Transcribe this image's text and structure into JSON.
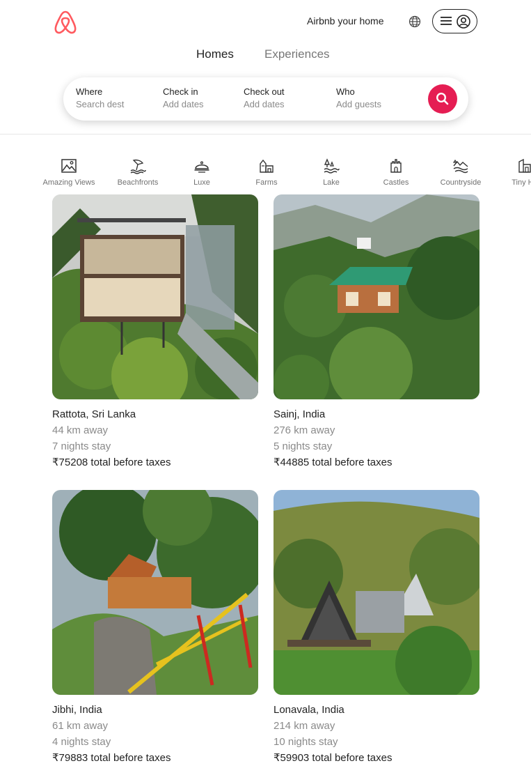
{
  "header": {
    "host_link": "Airbnb your home",
    "tabs": [
      {
        "label": "Homes"
      },
      {
        "label": "Experiences"
      }
    ]
  },
  "search": {
    "where": {
      "label": "Where",
      "value": "Search dest"
    },
    "checkin": {
      "label": "Check in",
      "value": "Add dates"
    },
    "checkout": {
      "label": "Check out",
      "value": "Add dates"
    },
    "who": {
      "label": "Who",
      "value": "Add guests"
    }
  },
  "categories": [
    {
      "label": "Amazing Views",
      "icon": "mountain-view-icon"
    },
    {
      "label": "Beachfronts",
      "icon": "beach-icon"
    },
    {
      "label": "Luxe",
      "icon": "luxe-icon"
    },
    {
      "label": "Farms",
      "icon": "farm-icon"
    },
    {
      "label": "Lake",
      "icon": "lake-icon"
    },
    {
      "label": "Castles",
      "icon": "castle-icon"
    },
    {
      "label": "Countryside",
      "icon": "countryside-icon"
    },
    {
      "label": "Tiny Ho",
      "icon": "tiny-home-icon"
    }
  ],
  "listings": [
    {
      "location": "Rattota, Sri Lanka",
      "distance": "44 km away",
      "stay": "7 nights stay",
      "price": "₹75208 total before taxes"
    },
    {
      "location": "Sainj, India",
      "distance": "276 km away",
      "stay": "5 nights stay",
      "price": "₹44885 total before taxes"
    },
    {
      "location": "Jibhi, India",
      "distance": "61 km away",
      "stay": "4 nights stay",
      "price": "₹79883 total before taxes"
    },
    {
      "location": "Lonavala, India",
      "distance": "214 km away",
      "stay": "10 nights stay",
      "price": "₹59903 total before taxes"
    }
  ],
  "colors": {
    "brand": "#FF5A5F",
    "search_button": "#E51D53",
    "muted": "#8A8A8A"
  }
}
